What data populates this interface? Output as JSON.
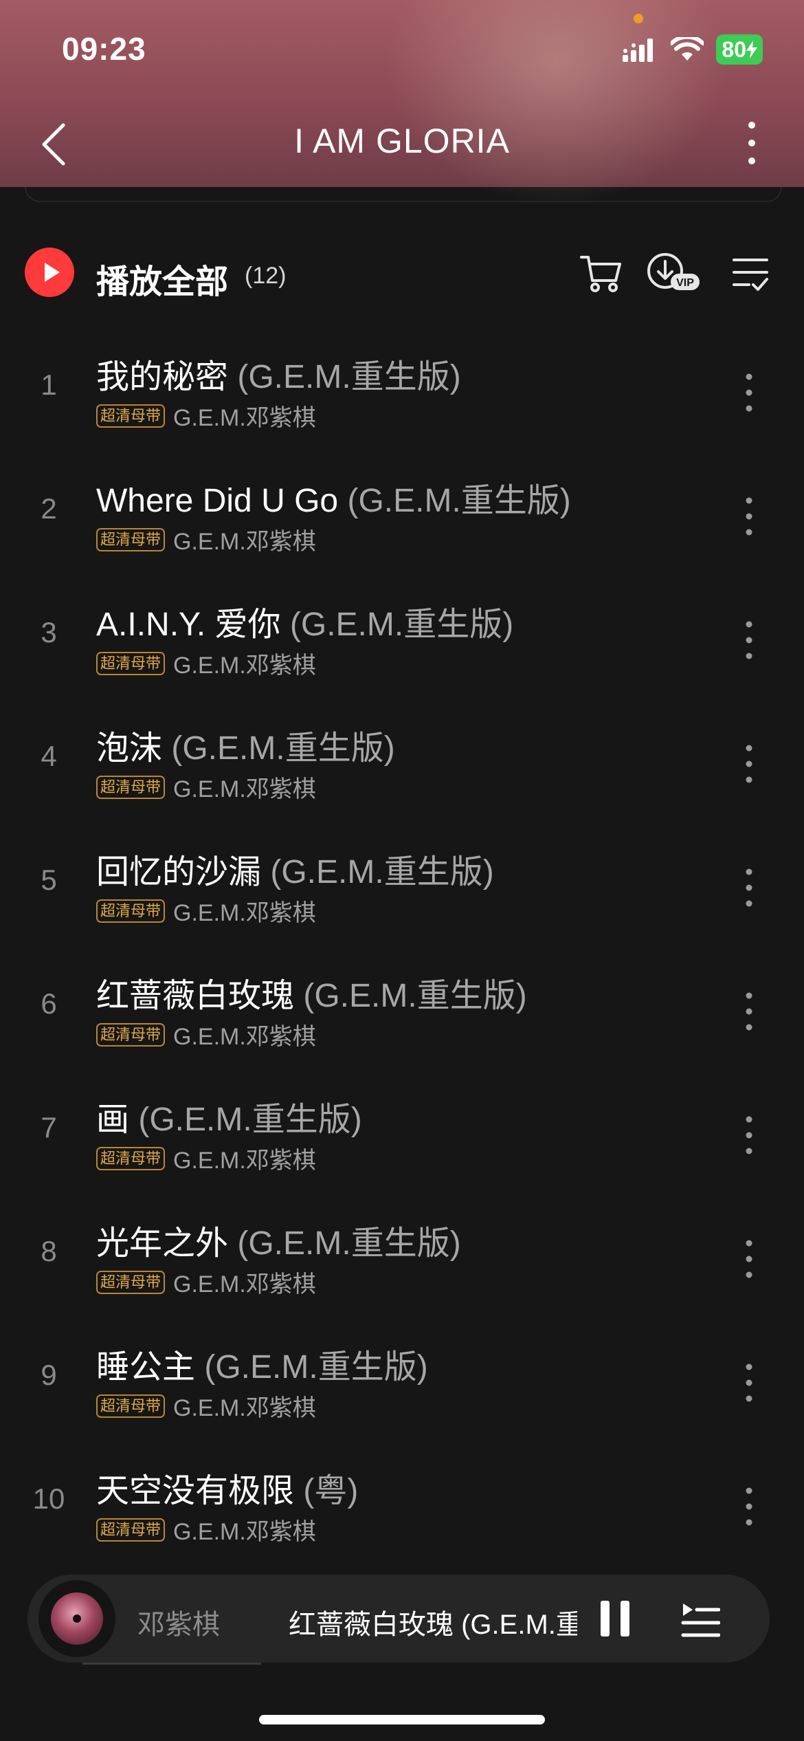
{
  "status_bar": {
    "time": "09:23",
    "battery": "80"
  },
  "header": {
    "title": "I AM GLORIA"
  },
  "play_all": {
    "label": "播放全部",
    "count": "(12)"
  },
  "songs": [
    {
      "index": "1",
      "title": "我的秘密",
      "version": "(G.E.M.重生版)",
      "badge": "超清母带",
      "artist": "G.E.M.邓紫棋"
    },
    {
      "index": "2",
      "title": "Where Did U Go",
      "version": "(G.E.M.重生版)",
      "badge": "超清母带",
      "artist": "G.E.M.邓紫棋"
    },
    {
      "index": "3",
      "title": "A.I.N.Y. 爱你",
      "version": "(G.E.M.重生版)",
      "badge": "超清母带",
      "artist": "G.E.M.邓紫棋"
    },
    {
      "index": "4",
      "title": "泡沫",
      "version": "(G.E.M.重生版)",
      "badge": "超清母带",
      "artist": "G.E.M.邓紫棋"
    },
    {
      "index": "5",
      "title": "回忆的沙漏",
      "version": "(G.E.M.重生版)",
      "badge": "超清母带",
      "artist": "G.E.M.邓紫棋"
    },
    {
      "index": "6",
      "title": "红蔷薇白玫瑰",
      "version": "(G.E.M.重生版)",
      "badge": "超清母带",
      "artist": "G.E.M.邓紫棋"
    },
    {
      "index": "7",
      "title": "画",
      "version": "(G.E.M.重生版)",
      "badge": "超清母带",
      "artist": "G.E.M.邓紫棋"
    },
    {
      "index": "8",
      "title": "光年之外",
      "version": "(G.E.M.重生版)",
      "badge": "超清母带",
      "artist": "G.E.M.邓紫棋"
    },
    {
      "index": "9",
      "title": "睡公主",
      "version": "(G.E.M.重生版)",
      "badge": "超清母带",
      "artist": "G.E.M.邓紫棋"
    },
    {
      "index": "10",
      "title": "天空没有极限",
      "version": "(粤)",
      "badge": "超清母带",
      "artist": "G.E.M.邓紫棋"
    }
  ],
  "mini_player": {
    "artist": "邓紫棋",
    "track": "红蔷薇白玫瑰 (G.E.M.重生版)"
  },
  "icons": {
    "back": "chevron-left-icon",
    "more": "more-vertical-icon",
    "play": "play-icon",
    "cart": "cart-icon",
    "download_vip": "download-vip-icon",
    "multi_select": "list-check-icon",
    "pause": "pause-icon",
    "queue": "playlist-icon"
  },
  "colors": {
    "accent": "#ff3a3a",
    "badge": "#e0a94a",
    "header": "#8b4a55",
    "background": "#161616",
    "battery": "#3ecb56"
  }
}
